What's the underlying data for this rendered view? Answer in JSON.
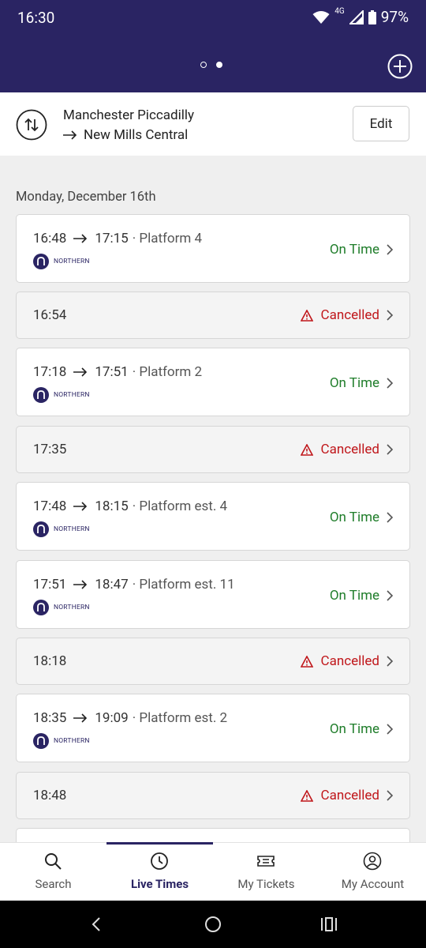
{
  "status_bar": {
    "time": "16:30",
    "network": "4G",
    "battery": "97%"
  },
  "header": {
    "page_indicator": {
      "count": 2,
      "active": 1
    }
  },
  "route": {
    "from": "Manchester Piccadilly",
    "to": "New Mills Central",
    "edit_label": "Edit"
  },
  "date_header": "Monday, December 16th",
  "services": [
    {
      "depart": "16:48",
      "arrive": "17:15",
      "platform": "· Platform 4",
      "operator": "NORTHERN",
      "status": "On Time",
      "cancelled": false
    },
    {
      "depart": "16:54",
      "status": "Cancelled",
      "cancelled": true
    },
    {
      "depart": "17:18",
      "arrive": "17:51",
      "platform": "· Platform 2",
      "operator": "NORTHERN",
      "status": "On Time",
      "cancelled": false
    },
    {
      "depart": "17:35",
      "status": "Cancelled",
      "cancelled": true
    },
    {
      "depart": "17:48",
      "arrive": "18:15",
      "platform": "· Platform est. 4",
      "operator": "NORTHERN",
      "status": "On Time",
      "cancelled": false
    },
    {
      "depart": "17:51",
      "arrive": "18:47",
      "platform": "· Platform est. 11",
      "operator": "NORTHERN",
      "status": "On Time",
      "cancelled": false
    },
    {
      "depart": "18:18",
      "status": "Cancelled",
      "cancelled": true
    },
    {
      "depart": "18:35",
      "arrive": "19:09",
      "platform": "· Platform est. 2",
      "operator": "NORTHERN",
      "status": "On Time",
      "cancelled": false
    },
    {
      "depart": "18:48",
      "status": "Cancelled",
      "cancelled": true
    }
  ],
  "bottom_nav": [
    {
      "label": "Search",
      "icon": "search-icon",
      "active": false
    },
    {
      "label": "Live Times",
      "icon": "clock-icon",
      "active": true
    },
    {
      "label": "My Tickets",
      "icon": "ticket-icon",
      "active": false
    },
    {
      "label": "My Account",
      "icon": "account-icon",
      "active": false
    }
  ],
  "colors": {
    "brand": "#2a2463",
    "on_time": "#1f7d2a",
    "cancelled": "#c0171b"
  }
}
